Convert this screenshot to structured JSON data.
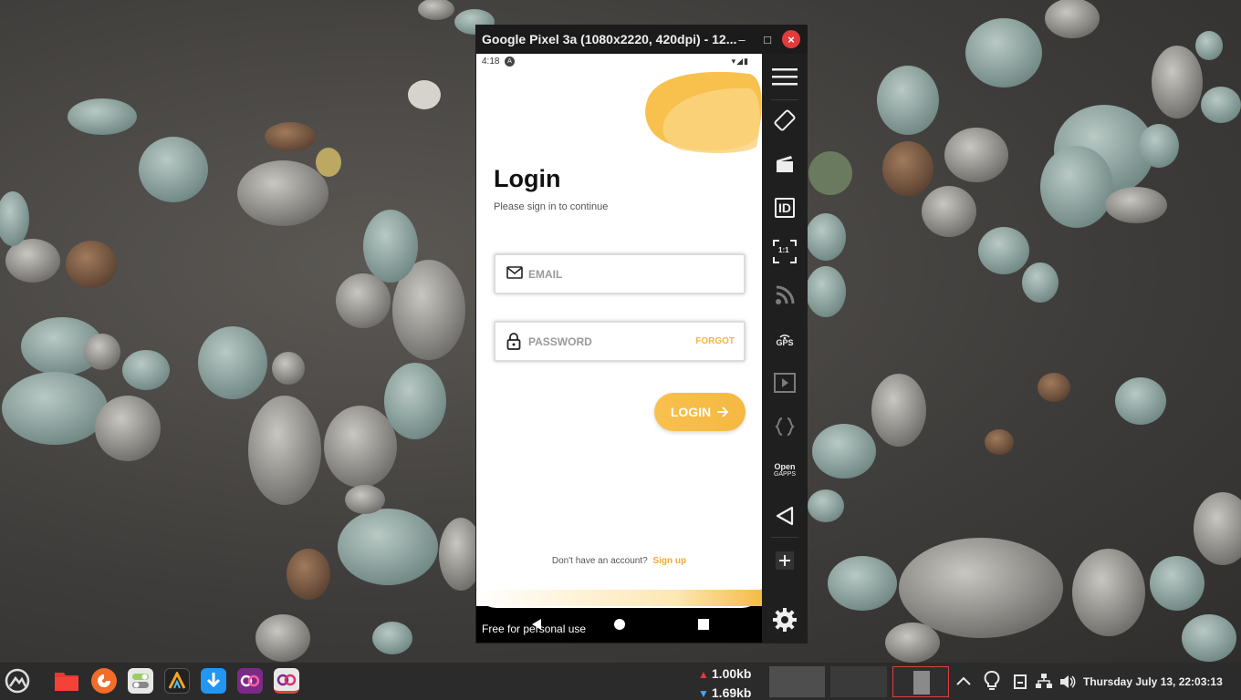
{
  "emulator": {
    "title": "Google Pixel 3a (1080x2220, 420dpi) - 12...",
    "minimize_glyph": "–",
    "maximize_glyph": "□",
    "close_glyph": "×"
  },
  "phone": {
    "status_time": "4:18",
    "status_a_glyph": "A",
    "status_icons": "▾◢▮",
    "login_title": "Login",
    "login_subtitle": "Please sign in to continue",
    "email_placeholder": "EMAIL",
    "password_placeholder": "PASSWORD",
    "forgot_label": "FORGOT",
    "login_button_label": "LOGIN",
    "signup_prompt": "Don't have an account?",
    "signup_link": "Sign up",
    "watermark": "Free for personal use",
    "accent": "#f5b942"
  },
  "toolbar": {
    "items": [
      {
        "icon": "menu-icon"
      },
      {
        "icon": "rotate-icon"
      },
      {
        "icon": "screen-record-icon"
      },
      {
        "icon": "device-id-icon",
        "label": "ID"
      },
      {
        "icon": "pixel-perfect-icon",
        "label": "1:1"
      },
      {
        "icon": "wifi-broadcast-icon"
      },
      {
        "icon": "gps-icon",
        "label": "GPS"
      },
      {
        "icon": "media-icon"
      },
      {
        "icon": "developer-icon"
      },
      {
        "icon": "open-gapps-icon",
        "label_line1": "Open",
        "label_line2": "GAPPS"
      },
      {
        "icon": "back-icon"
      },
      {
        "icon": "add-icon"
      },
      {
        "icon": "settings-icon"
      }
    ]
  },
  "taskbar": {
    "apps": [
      "launcher-icon",
      "files-icon",
      "firefox-icon",
      "settings-switch-icon",
      "terminal-icon",
      "downloader-icon",
      "genymotion-icon",
      "genymotion-active-icon"
    ],
    "net_up": "1.00kb",
    "net_down": "1.69kb",
    "clock": "Thursday July 13, 22:03:13"
  }
}
